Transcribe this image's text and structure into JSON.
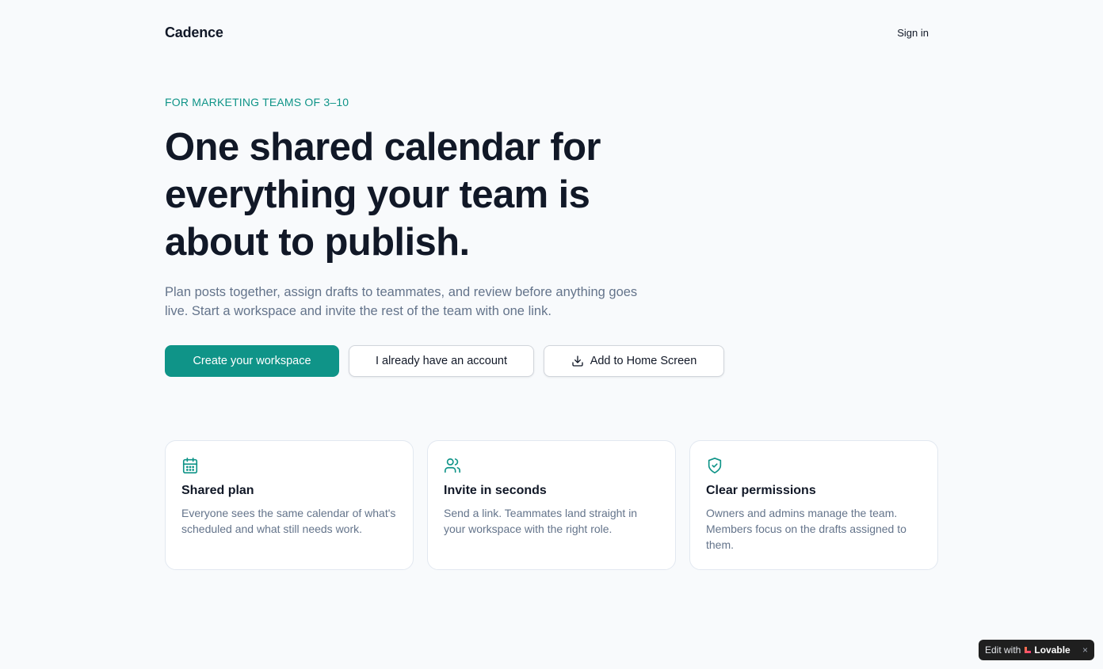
{
  "header": {
    "brand": "Cadence",
    "sign_in_label": "Sign in"
  },
  "hero": {
    "eyebrow": "FOR MARKETING TEAMS OF 3–10",
    "headline_lines": [
      "One shared calendar for",
      "everything your team is",
      "about to publish."
    ],
    "subtext": "Plan posts together, assign drafts to teammates, and review before anything goes live. Start a workspace and invite the rest of the team with one link."
  },
  "actions": {
    "primary_label": "Create your workspace",
    "account_label": "I already have an account",
    "home_screen_label": "Add to Home Screen",
    "home_screen_icon": "download-icon"
  },
  "features": [
    {
      "icon": "calendar-icon",
      "title": "Shared plan",
      "body": "Everyone sees the same calendar of what's scheduled and what still needs work."
    },
    {
      "icon": "users-icon",
      "title": "Invite in seconds",
      "body": "Send a link. Teammates land straight in your workspace with the right role."
    },
    {
      "icon": "shield-check-icon",
      "title": "Clear permissions",
      "body": "Owners and admins manage the team. Members focus on the drafts assigned to them."
    }
  ],
  "badge": {
    "prefix": "Edit with",
    "brand": "Lovable",
    "close_glyph": "×"
  },
  "colors": {
    "accent": "#0f9488",
    "background": "#f8fafc",
    "text_primary": "#111827",
    "text_muted": "#64748b"
  }
}
